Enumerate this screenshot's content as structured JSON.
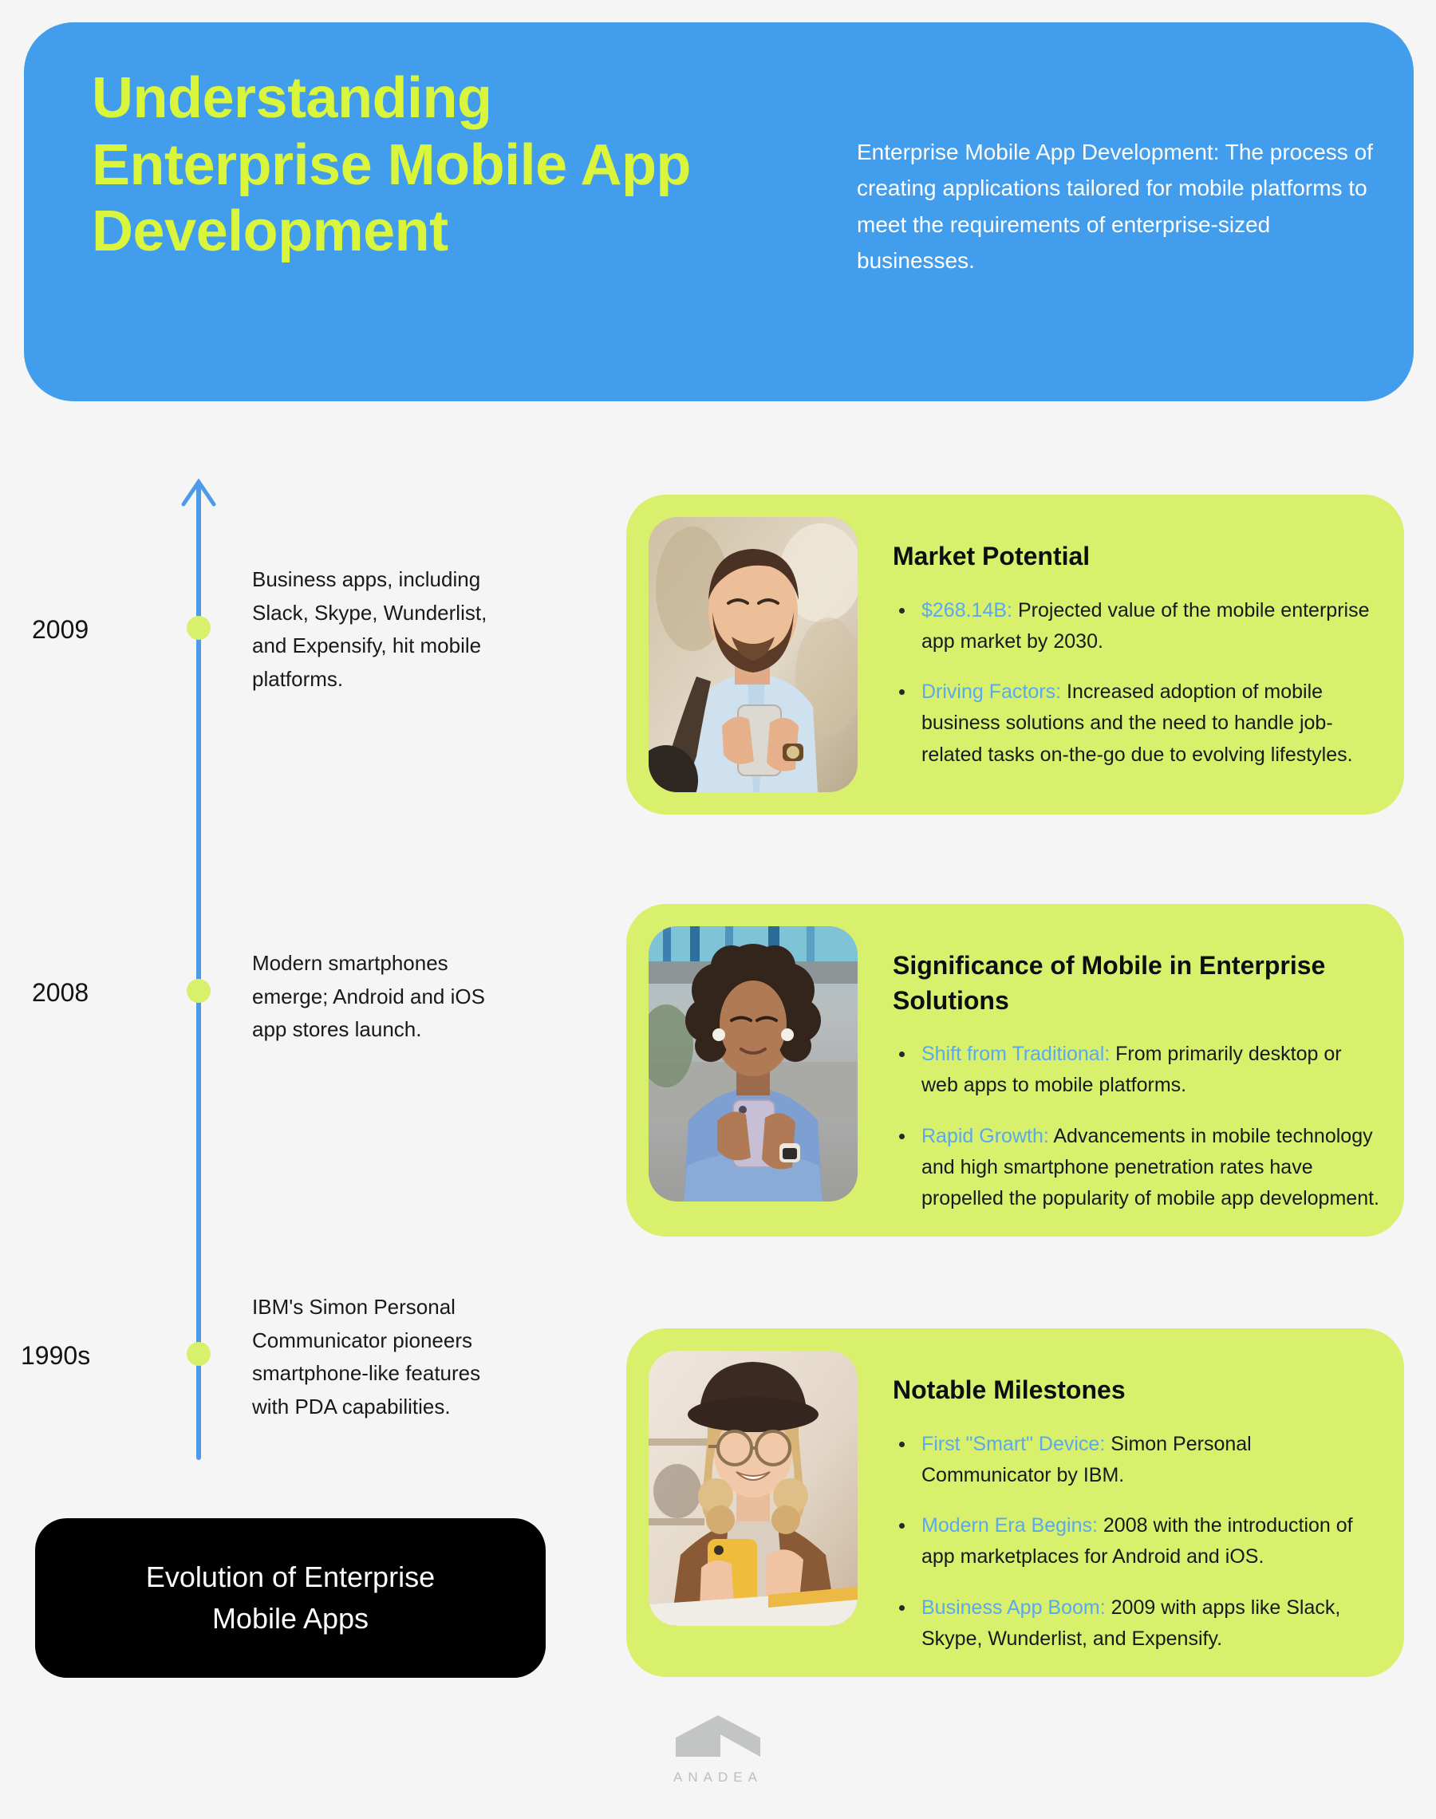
{
  "header": {
    "title": "Understanding Enterprise Mobile App Development",
    "description": "Enterprise Mobile App Development: The process of creating applications tailored for mobile platforms to meet the requirements of enterprise-sized businesses.",
    "background_color": "#439ded",
    "title_color": "#d9f63c"
  },
  "timeline": {
    "axis_color": "#4d9ae8",
    "dot_color": "#d9f06c",
    "direction_icon": "up-arrow-icon",
    "entries": [
      {
        "year": "2009",
        "text": "Business apps, including Slack, Skype, Wunderlist, and Expensify, hit mobile platforms."
      },
      {
        "year": "2008",
        "text": "Modern smartphones emerge; Android and iOS app stores launch."
      },
      {
        "year": "1990s",
        "text": "IBM's Simon Personal Communicator pioneers smartphone-like features with PDA capabilities."
      }
    ]
  },
  "badge": {
    "label": "Evolution of Enterprise Mobile Apps",
    "background_color": "#000000",
    "text_color": "#ffffff"
  },
  "cards": [
    {
      "title": "Market Potential",
      "photo_alt": "bearded-man-with-backpack-using-smartphone-photo",
      "bullets": [
        {
          "lead": "$268.14B:",
          "text": " Projected value of the mobile enterprise app market by 2030."
        },
        {
          "lead": "Driving Factors:",
          "text": " Increased adoption of mobile business solutions and the need to handle job-related tasks on-the-go due to evolving lifestyles."
        }
      ]
    },
    {
      "title": "Significance of Mobile in Enterprise Solutions",
      "photo_alt": "woman-with-curly-hair-in-blue-sweater-using-smartphone-photo",
      "bullets": [
        {
          "lead": "Shift from Traditional:",
          "text": " From primarily desktop or web apps to mobile platforms."
        },
        {
          "lead": "Rapid Growth:",
          "text": " Advancements in mobile technology and high smartphone penetration rates have propelled the popularity of mobile app development."
        }
      ]
    },
    {
      "title": "Notable Milestones",
      "photo_alt": "blonde-woman-with-hat-and-glasses-holding-yellow-smartphone-photo",
      "bullets": [
        {
          "lead": "First \"Smart\" Device:",
          "text": " Simon Personal Communicator by IBM."
        },
        {
          "lead": "Modern Era Begins:",
          "text": " 2008 with the introduction of app marketplaces for Android and iOS."
        },
        {
          "lead": "Business App Boom:",
          "text": " 2009 with apps like Slack, Skype, Wunderlist, and Expensify."
        }
      ]
    }
  ],
  "footer": {
    "brand": "ANADEA",
    "mark_icon": "chevron-roof-logo-icon",
    "mark_color": "#c3c4c4"
  },
  "theme": {
    "page_background": "#f4f5f4",
    "card_background": "#d9f06c",
    "lead_accent": "#5aa8ed",
    "body_text": "#17191c"
  }
}
